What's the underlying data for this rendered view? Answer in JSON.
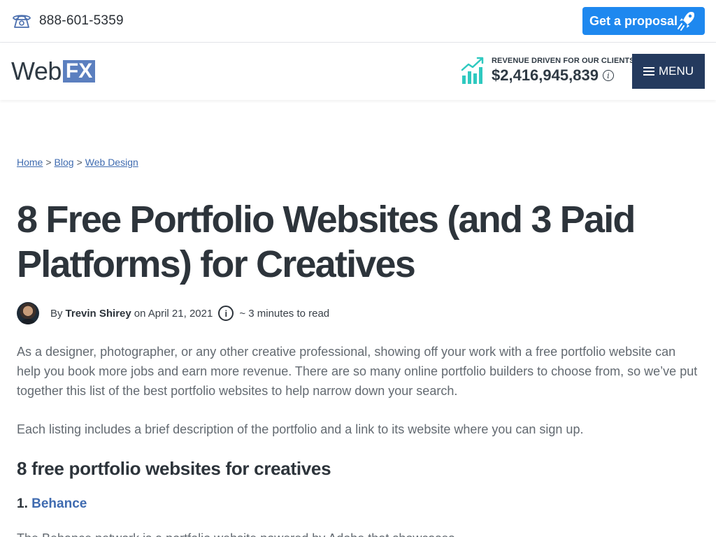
{
  "topbar": {
    "phone_icon": "phone-icon",
    "phone": "888-601-5359",
    "proposal_label": "Get a proposal",
    "rocket_icon": "rocket-icon"
  },
  "header": {
    "logo_web": "Web",
    "logo_fx": "FX",
    "revenue_label": "REVENUE DRIVEN FOR OUR CLIENTS",
    "revenue_amount": "$2,416,945,839",
    "info_glyph": "i",
    "menu_label": "MENU"
  },
  "breadcrumb": {
    "items": [
      "Home",
      "Blog",
      "Web Design"
    ],
    "separator": ">"
  },
  "article": {
    "title_line1": "8 Free Portfolio Websites (and 3 Paid",
    "title_line2": "Platforms) for Creatives",
    "by": "By",
    "author": "Trevin Shirey",
    "date": "on April 21, 2021",
    "info_glyph": "i",
    "read_time": "~ 3 minutes to read",
    "para1": "As a designer, photographer, or any other creative professional, showing off your work with a free portfolio website can help you book more jobs and earn more revenue. There are so many online portfolio builders to choose from, so we’ve put together this list of the best portfolio websites to help narrow down your search.",
    "para2": "Each listing includes a brief description of the portfolio and a link to its website where you can sign up.",
    "h2": "8 free portfolio websites for creatives",
    "item1_num": "1.",
    "item1_link": "Behance",
    "next_para": "The Behance network is a portfolio website powered by Adobe that showcases"
  },
  "colors": {
    "accent_blue": "#1e88ef",
    "menu_navy": "#243a5e",
    "link": "#3f6bb0",
    "logo_fx": "#5b7fbf",
    "chart_teal": "#2fc9c0"
  }
}
